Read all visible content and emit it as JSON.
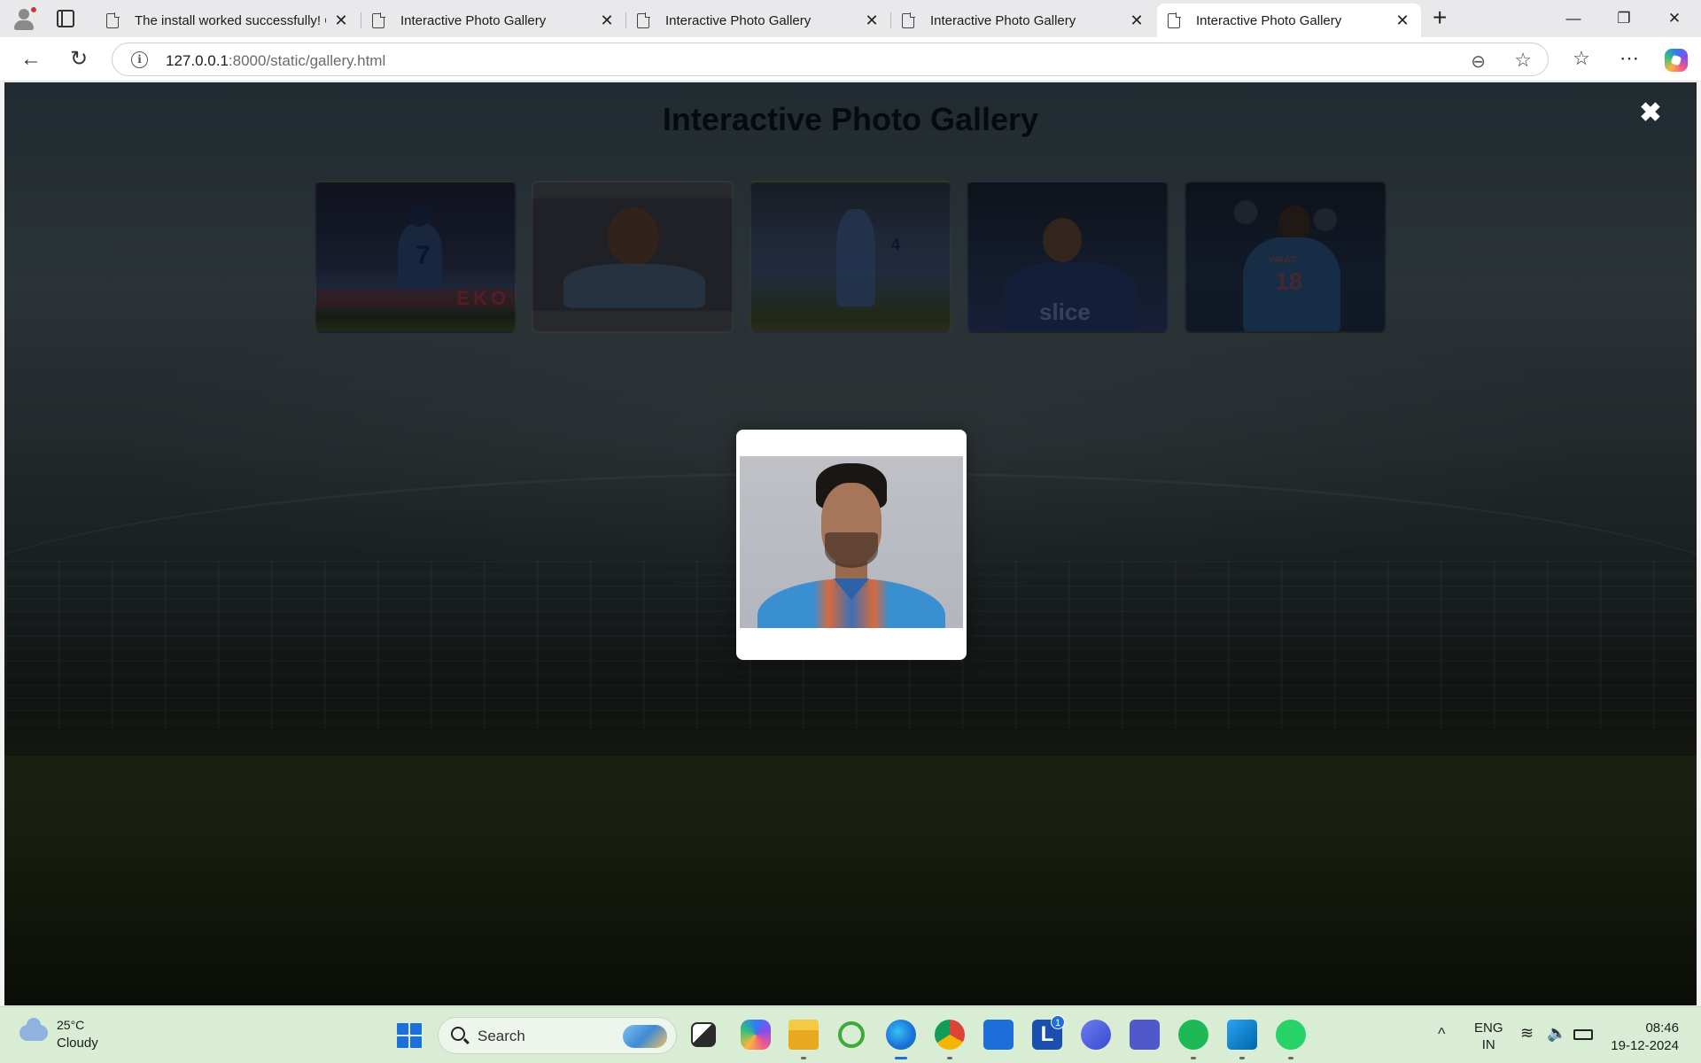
{
  "browser": {
    "tabs": [
      {
        "title": "The install worked successfully! Co",
        "active": false
      },
      {
        "title": "Interactive Photo Gallery",
        "active": false
      },
      {
        "title": "Interactive Photo Gallery",
        "active": false
      },
      {
        "title": "Interactive Photo Gallery",
        "active": false
      },
      {
        "title": "Interactive Photo Gallery",
        "active": true
      }
    ],
    "new_tab_symbol": "+",
    "tab_close_symbol": "✕",
    "window_controls": {
      "minimize": "—",
      "restore": "❐",
      "close": "✕"
    },
    "address": {
      "host": "127.0.0.1",
      "path": ":8000/static/gallery.html",
      "info_symbol": "i"
    },
    "icons": [
      "back-icon",
      "refresh-icon",
      "info-icon",
      "zoom-out-icon",
      "favorite-star-icon",
      "favorites-icon",
      "more-icon",
      "copilot-icon"
    ]
  },
  "page": {
    "title": "Interactive Photo Gallery",
    "close_symbol": "✖",
    "thumbnails": [
      {
        "jersey": "7",
        "banner": "EKO"
      },
      {
        "jersey": ""
      },
      {
        "jersey": "4"
      },
      {
        "jersey": "",
        "banner": "slice"
      },
      {
        "jersey": "18",
        "name": "VIRAT"
      }
    ],
    "modal": {
      "visible": true,
      "selected_index": 1
    }
  },
  "taskbar": {
    "weather": {
      "temp": "25°C",
      "condition": "Cloudy"
    },
    "search_label": "Search",
    "apps": [
      "task-view",
      "copilot",
      "file-explorer",
      "app-circle",
      "edge",
      "chrome",
      "microsoft-store",
      "lens-l",
      "app-triangle",
      "teams",
      "spotify",
      "vscode",
      "whatsapp"
    ],
    "badge_count": "1",
    "language": {
      "line1": "ENG",
      "line2": "IN"
    },
    "clock": {
      "time": "08:46",
      "date": "19-12-2024"
    },
    "colors": {
      "taskbar": "#d9ecd4",
      "windows_blue": "#1e6fd9"
    }
  }
}
